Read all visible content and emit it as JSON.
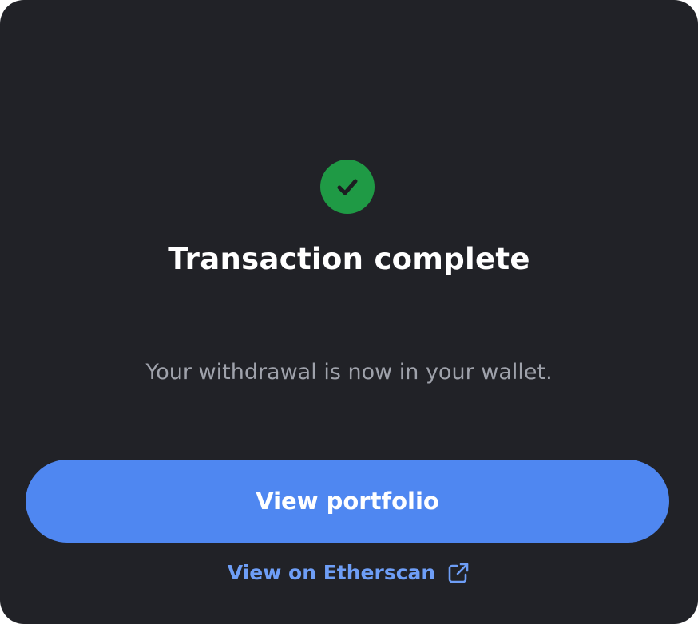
{
  "dialog": {
    "status_icon": "check-circle-icon",
    "title": "Transaction complete",
    "message": "Your withdrawal is now in your wallet.",
    "primary_button_label": "View portfolio",
    "link_label": "View on Etherscan",
    "link_icon": "external-link-icon"
  },
  "colors": {
    "background": "#212227",
    "success": "#1f9a45",
    "primary": "#4f87f1",
    "link": "#6e9ef6",
    "muted_text": "#9fa2ab"
  }
}
